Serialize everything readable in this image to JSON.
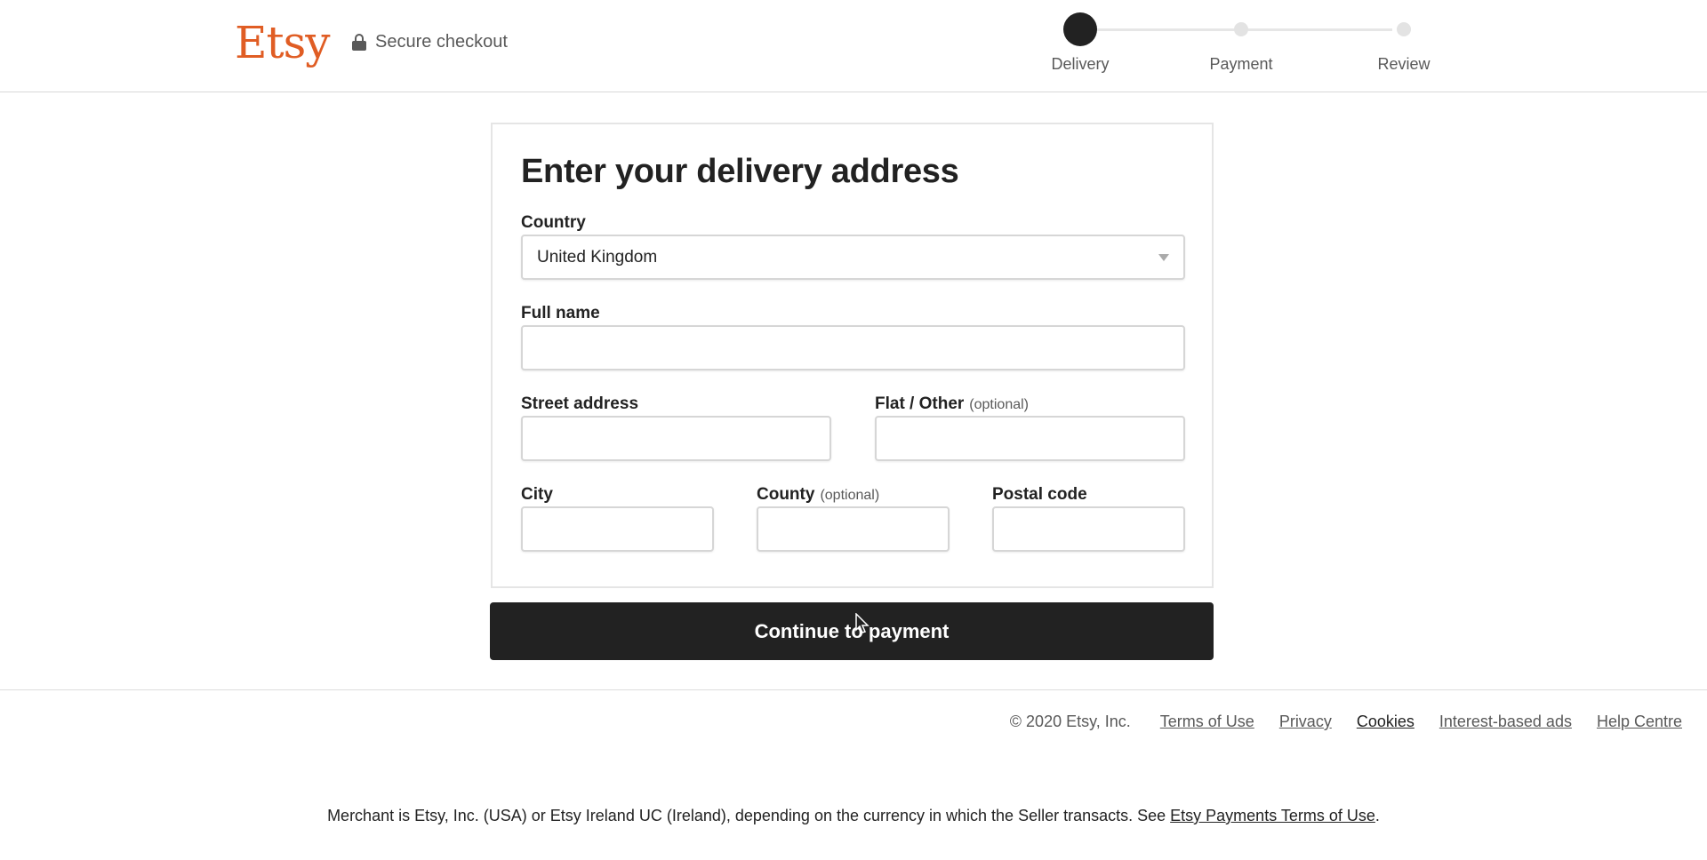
{
  "header": {
    "logo": "Etsy",
    "secure_label": "Secure checkout",
    "brand_color": "#e05d24"
  },
  "steps": [
    {
      "label": "Delivery",
      "active": true
    },
    {
      "label": "Payment",
      "active": false
    },
    {
      "label": "Review",
      "active": false
    }
  ],
  "form": {
    "title": "Enter your delivery address",
    "country": {
      "label": "Country",
      "value": "United Kingdom"
    },
    "full_name": {
      "label": "Full name",
      "value": ""
    },
    "street": {
      "label": "Street address",
      "value": ""
    },
    "flat": {
      "label": "Flat / Other",
      "optional": "(optional)",
      "value": ""
    },
    "city": {
      "label": "City",
      "value": ""
    },
    "county": {
      "label": "County",
      "optional": "(optional)",
      "value": ""
    },
    "postal": {
      "label": "Postal code",
      "value": ""
    },
    "continue_label": "Continue to payment"
  },
  "footer": {
    "copyright": "© 2020 Etsy, Inc.",
    "links": [
      "Terms of Use",
      "Privacy",
      "Cookies",
      "Interest-based ads",
      "Help Centre"
    ],
    "merchant_text": "Merchant is Etsy, Inc. (USA) or Etsy Ireland UC (Ireland), depending on the currency in which the Seller transacts. See ",
    "merchant_link": "Etsy Payments Terms of Use",
    "merchant_end": "."
  }
}
